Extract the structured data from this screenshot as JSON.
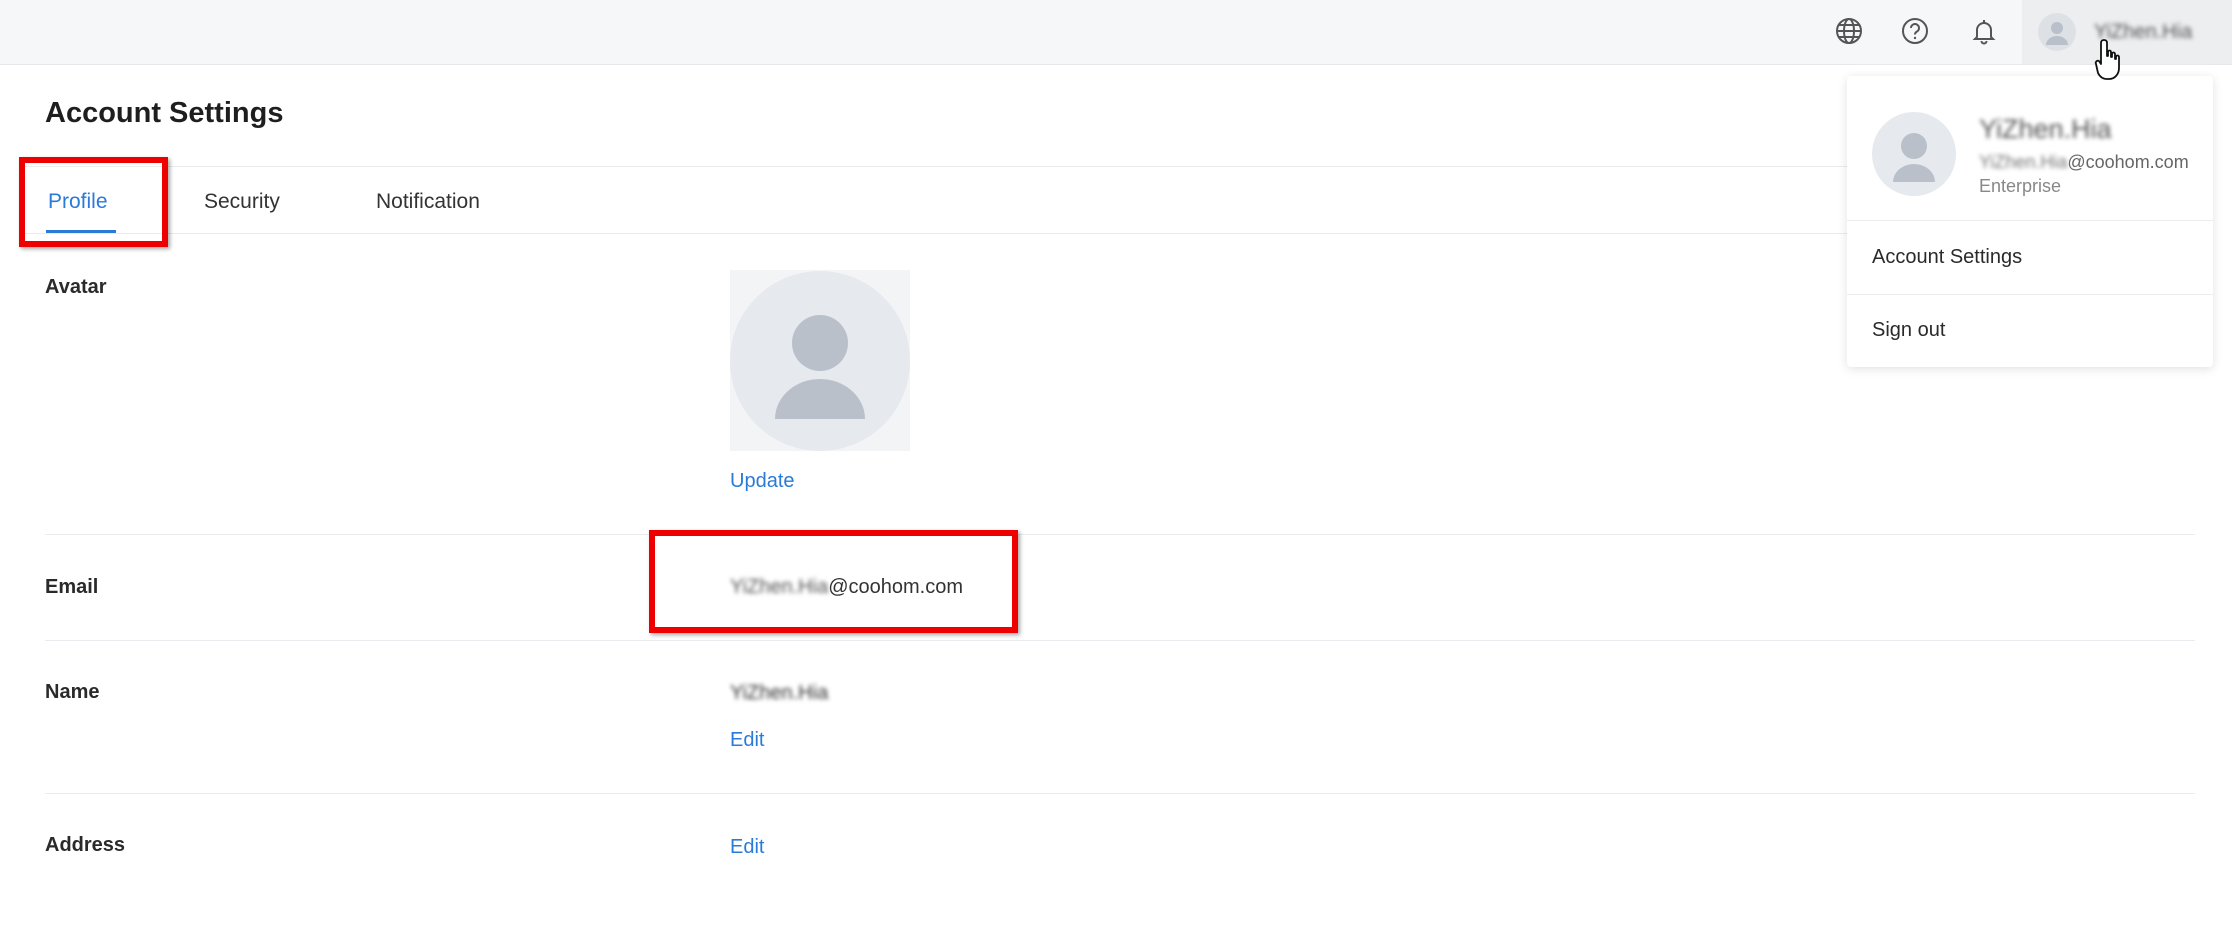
{
  "topbar": {
    "icons": [
      "globe-icon",
      "help-icon",
      "bell-icon"
    ],
    "user_name": "YiZhen.Hia"
  },
  "page": {
    "title": "Account Settings"
  },
  "tabs": [
    {
      "label": "Profile",
      "active": true
    },
    {
      "label": "Security",
      "active": false
    },
    {
      "label": "Notification",
      "active": false
    }
  ],
  "profile": {
    "avatar_label": "Avatar",
    "avatar_action": "Update",
    "email_label": "Email",
    "email_user": "YiZhen.Hia",
    "email_domain": "@coohom.com",
    "name_label": "Name",
    "name_value": "YiZhen.Hia",
    "name_action": "Edit",
    "address_label": "Address",
    "address_action": "Edit"
  },
  "dropdown": {
    "name": "YiZhen.Hia",
    "email_user": "YiZhen.Hia",
    "email_domain": "@coohom.com",
    "plan": "Enterprise",
    "items": [
      "Account Settings",
      "Sign out"
    ]
  },
  "colors": {
    "accent": "#2a7ad8",
    "highlight": "#ee0000",
    "topbar_bg": "#f6f7f8"
  }
}
